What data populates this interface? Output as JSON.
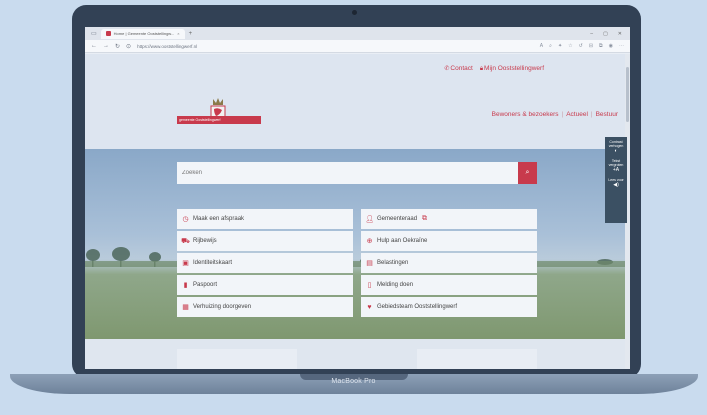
{
  "device": {
    "label": "MacBook Pro"
  },
  "browser": {
    "tab_title": "Home | Gemeente Ooststellingw...",
    "tab_close": "×",
    "new_tab": "+",
    "url": "https://www.ooststellingwerf.nl",
    "win_min": "–",
    "win_max": "▢",
    "win_close": "✕"
  },
  "top_links": {
    "contact": "Contact",
    "mijn": "Mijn Ooststellingwerf"
  },
  "logo": {
    "text": "gemeente Ooststellingwerf"
  },
  "main_nav": {
    "item1": "Bewoners & bezoekers",
    "item2": "Actueel",
    "item3": "Bestuur",
    "sep": "|"
  },
  "search": {
    "placeholder": "Zoeken"
  },
  "tiles": [
    {
      "label": "Maak een afspraak",
      "icon": "clock-icon"
    },
    {
      "label": "Gemeenteraad",
      "icon": "person-icon"
    },
    {
      "label": "Rijbewijs",
      "icon": "car-icon"
    },
    {
      "label": "Hulp aan Oekraïne",
      "icon": "plus-icon"
    },
    {
      "label": "Identiteitskaart",
      "icon": "id-card-icon"
    },
    {
      "label": "Belastingen",
      "icon": "document-icon"
    },
    {
      "label": "Paspoort",
      "icon": "passport-icon"
    },
    {
      "label": "Melding doen",
      "icon": "phone-icon"
    },
    {
      "label": "Verhuizing doorgeven",
      "icon": "briefcase-icon"
    },
    {
      "label": "Gebiedsteam Ooststellingwerf",
      "icon": "heart-icon"
    }
  ],
  "side_widget": {
    "contrast": "Contrast verhogen",
    "text": "Tekst vergroten",
    "read": "Lees voor"
  },
  "colors": {
    "brand": "#c83a4c",
    "widget": "#3b5063"
  }
}
